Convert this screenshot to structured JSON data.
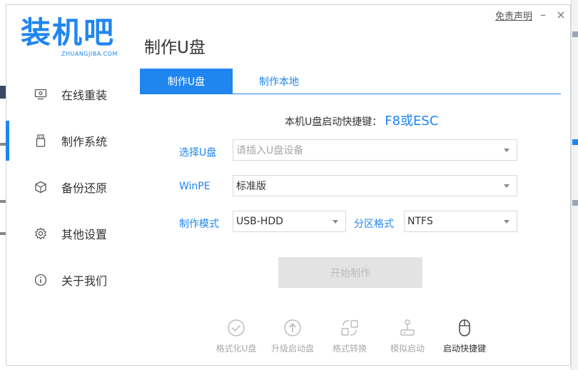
{
  "logo": {
    "main": "装机吧",
    "sub": "ZHUANGJIBA.COM"
  },
  "page_title": "制作U盘",
  "window": {
    "disclaimer": "免责声明",
    "minimize": "–",
    "close": "×"
  },
  "sidebar": {
    "items": [
      {
        "label": "在线重装",
        "icon": "monitor-icon",
        "active": false
      },
      {
        "label": "制作系统",
        "icon": "usb-drive-icon",
        "active": true
      },
      {
        "label": "备份还原",
        "icon": "backup-cube-icon",
        "active": false
      },
      {
        "label": "其他设置",
        "icon": "gear-icon",
        "active": false
      },
      {
        "label": "关于我们",
        "icon": "info-icon",
        "active": false
      }
    ]
  },
  "tabs": [
    {
      "label": "制作U盘",
      "active": true
    },
    {
      "label": "制作本地",
      "active": false
    }
  ],
  "hotkey": {
    "label": "本机U盘启动快捷键：",
    "keys": "F8或ESC"
  },
  "form": {
    "usb_label": "选择U盘",
    "usb_placeholder": "请插入U盘设备",
    "winpe_label": "WinPE",
    "winpe_value": "标准版",
    "mode_label": "制作模式",
    "mode_value": "USB-HDD",
    "partition_label": "分区格式",
    "partition_value": "NTFS"
  },
  "start_button": "开始制作",
  "tools": [
    {
      "label": "格式化U盘",
      "icon": "check-circle-icon",
      "active": false
    },
    {
      "label": "升级启动盘",
      "icon": "arrow-up-circle-icon",
      "active": false
    },
    {
      "label": "格式转换",
      "icon": "convert-icon",
      "active": false
    },
    {
      "label": "模拟启动",
      "icon": "joystick-icon",
      "active": false
    },
    {
      "label": "启动快捷键",
      "icon": "mouse-icon",
      "active": true
    }
  ],
  "colors": {
    "accent": "#1f86f0",
    "disabled": "#e3e3e3"
  }
}
